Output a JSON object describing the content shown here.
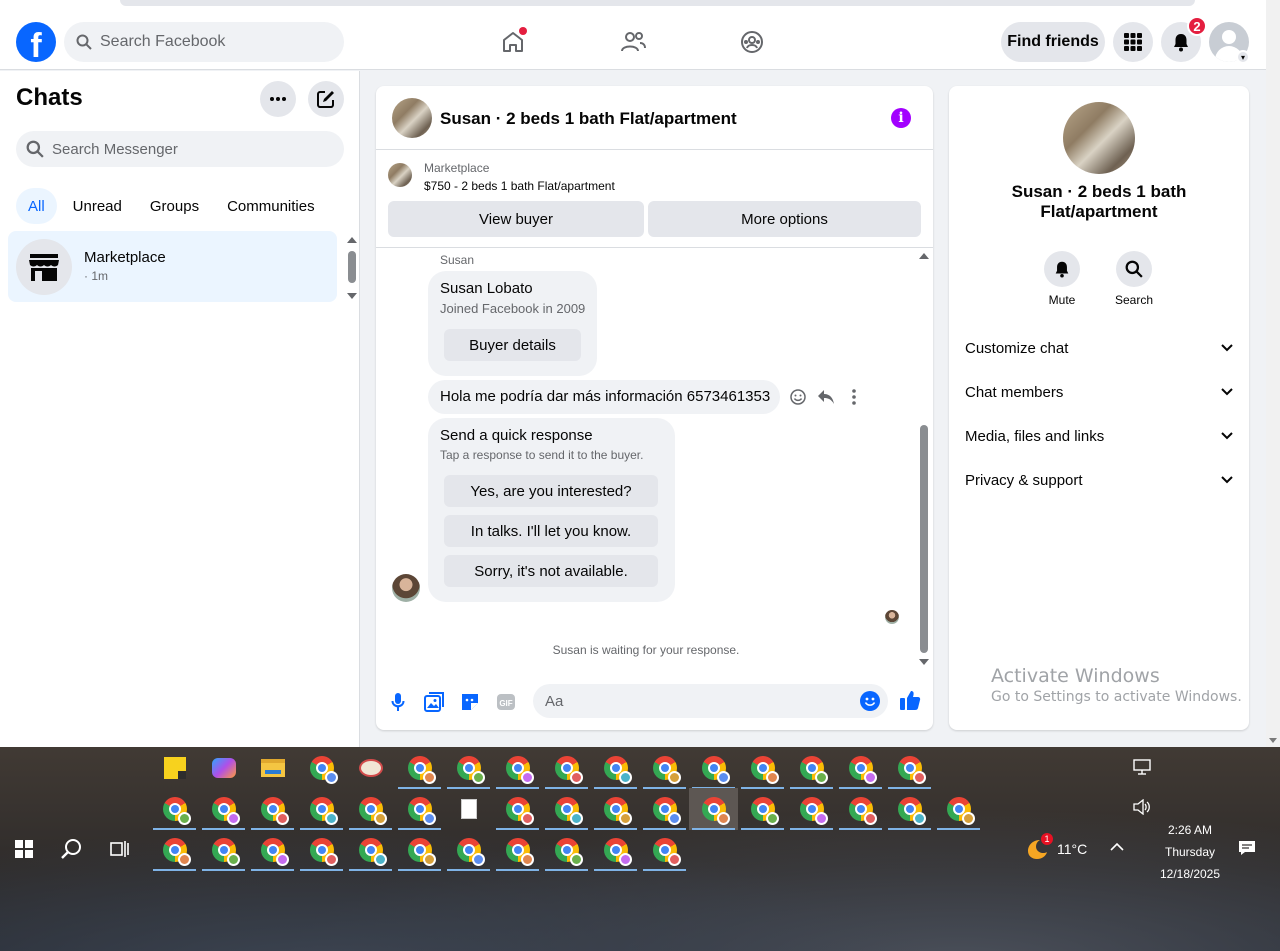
{
  "nav": {
    "search_placeholder": "Search Facebook",
    "find_friends": "Find friends",
    "notifications_count": "2"
  },
  "sidebar": {
    "title": "Chats",
    "search_placeholder": "Search Messenger",
    "filters": [
      "All",
      "Unread",
      "Groups",
      "Communities"
    ],
    "chat": {
      "name": "Marketplace",
      "time": "· 1m"
    }
  },
  "conversation": {
    "title": "Susan · 2 beds 1 bath Flat/apartment",
    "marketplace_label": "Marketplace",
    "listing": "$750 - 2 beds 1 bath Flat/apartment",
    "view_buyer": "View buyer",
    "more_options": "More options",
    "sender": "Susan",
    "buyer_card": {
      "name": "Susan Lobato",
      "joined": "Joined Facebook in 2009",
      "button": "Buyer details"
    },
    "message": "Hola me podría dar más información 6573461353",
    "quick": {
      "title": "Send a quick response",
      "subtitle": "Tap a response to send it to the buyer.",
      "options": [
        "Yes, are you interested?",
        "In talks. I'll let you know.",
        "Sorry, it's not available."
      ]
    },
    "waiting": "Susan is waiting for your response.",
    "composer_placeholder": "Aa"
  },
  "details": {
    "title": "Susan · 2 beds 1 bath Flat/apartment",
    "actions": [
      "Mute",
      "Search"
    ],
    "sections": [
      "Customize chat",
      "Chat members",
      "Media, files and links",
      "Privacy & support"
    ]
  },
  "watermark": {
    "line1": "Activate Windows",
    "line2": "Go to Settings to activate Windows."
  },
  "taskbar": {
    "weather": "11°C",
    "weather_badge": "1",
    "time": "2:26 AM",
    "day": "Thursday",
    "date": "12/18/2025"
  },
  "colors": {
    "accent": "#0866ff",
    "badge": "#e41e3f",
    "info": "#a200ff"
  }
}
